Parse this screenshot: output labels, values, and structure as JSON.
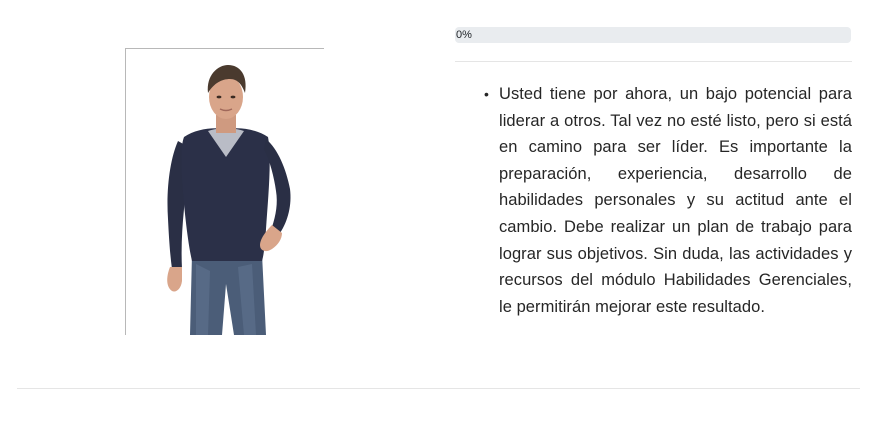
{
  "progress": {
    "label": "0%",
    "percent": 0,
    "fill_color": "#0d6efd",
    "track_color": "#e9ecef"
  },
  "illustration": {
    "icon": "avatar-figure-icon"
  },
  "result": {
    "items": [
      "Usted tiene por ahora, un bajo potencial para liderar a otros. Tal vez no esté listo, pero si está en camino para ser líder. Es importante la preparación, experiencia, desarrollo de habilidades personales y su actitud ante el cambio. Debe realizar un plan de trabajo para lograr sus objetivos. Sin duda, las actividades y recursos del módulo Habilidades Gerenciales, le permitirán mejorar este resultado."
    ]
  }
}
